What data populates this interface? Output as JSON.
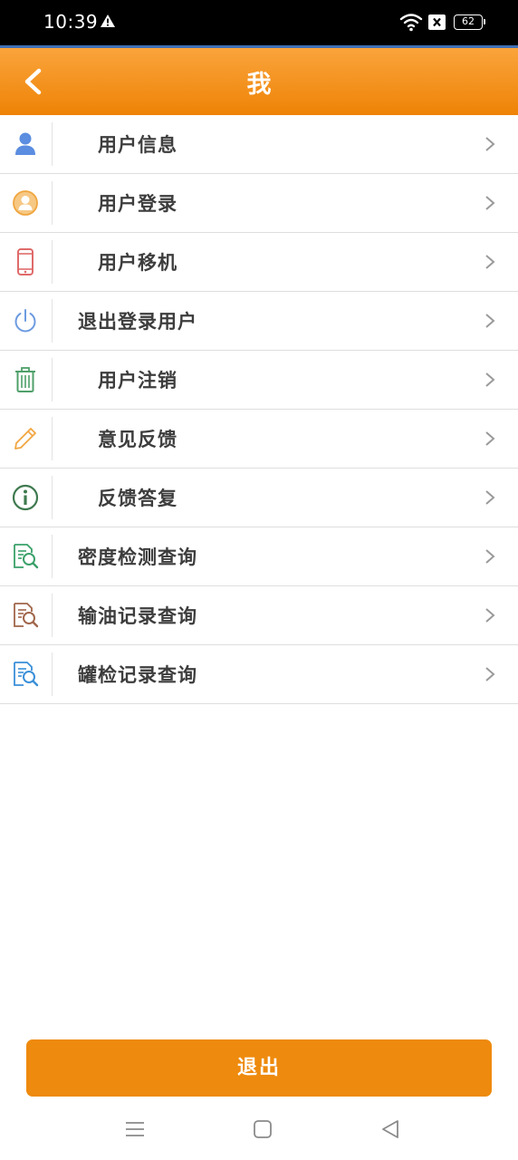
{
  "status_bar": {
    "time": "10:39",
    "battery": "62",
    "icons": [
      "warning-icon",
      "wifi-icon",
      "x-box-icon",
      "battery-icon"
    ]
  },
  "header": {
    "title": "我",
    "back_icon": "back-chevron-icon"
  },
  "menu": {
    "items": [
      {
        "label": "用户信息",
        "icon": "user-silhouette-icon",
        "icon_color": "#5b8de0"
      },
      {
        "label": "用户登录",
        "icon": "user-circle-icon",
        "icon_color": "#f0a640"
      },
      {
        "label": "用户移机",
        "icon": "phone-icon",
        "icon_color": "#e06a6a"
      },
      {
        "label": "退出登录用户",
        "icon": "power-icon",
        "icon_color": "#6c9be0"
      },
      {
        "label": "用户注销",
        "icon": "trash-icon",
        "icon_color": "#4fa06a"
      },
      {
        "label": "意见反馈",
        "icon": "pencil-icon",
        "icon_color": "#f0a640"
      },
      {
        "label": "反馈答复",
        "icon": "info-icon",
        "icon_color": "#3f7a4f"
      },
      {
        "label": "密度检测查询",
        "icon": "document-search-icon",
        "icon_color": "#3aa06a"
      },
      {
        "label": "输油记录查询",
        "icon": "document-search-icon",
        "icon_color": "#a0664a"
      },
      {
        "label": "罐检记录查询",
        "icon": "document-search-icon",
        "icon_color": "#3a8fd8"
      }
    ]
  },
  "footer": {
    "logout_label": "退出"
  },
  "colors": {
    "accent": "#ee8a0d",
    "header_top": "#faa43c",
    "header_bottom": "#ee8306"
  }
}
